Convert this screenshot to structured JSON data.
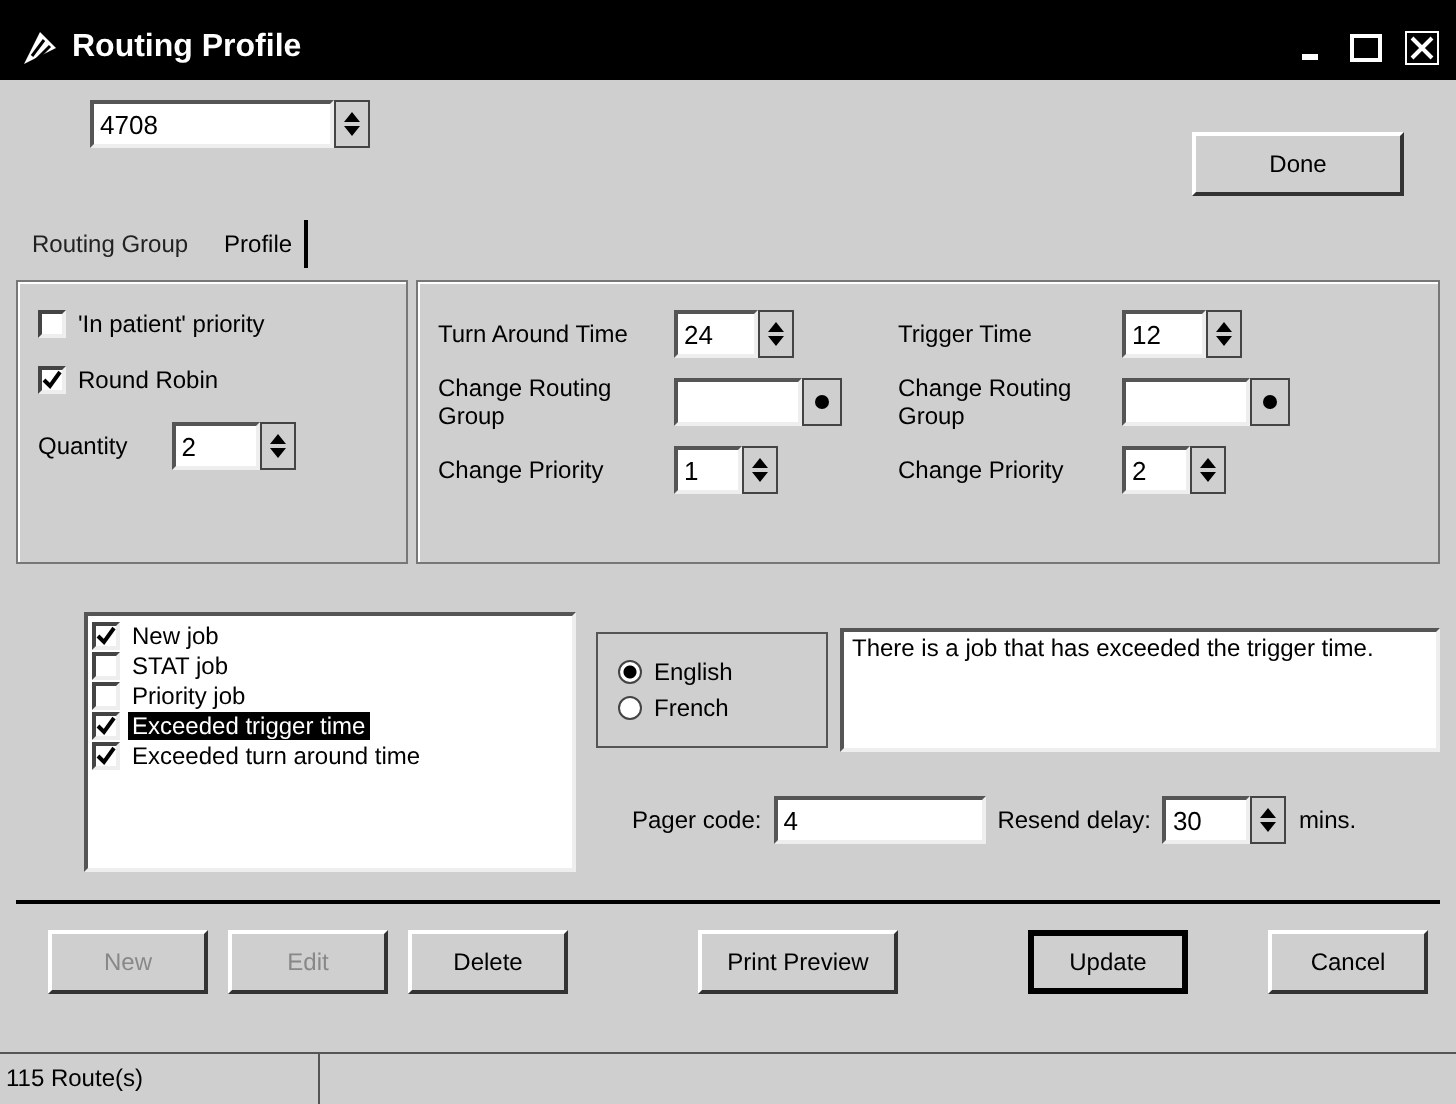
{
  "window": {
    "title": "Routing Profile"
  },
  "record": {
    "value": "4708"
  },
  "done_button": {
    "label": "Done"
  },
  "tabs": [
    {
      "label": "Routing Group",
      "selected": false
    },
    {
      "label": "Profile",
      "selected": true
    }
  ],
  "options": [
    {
      "label": "'In patient' priority",
      "checked": false
    },
    {
      "label": "Round Robin",
      "checked": true
    }
  ],
  "quantity": {
    "label": "Quantity",
    "value": "2"
  },
  "timing": [
    {
      "time_label": "Turn Around Time",
      "time_value": "24",
      "routing_label": "Change Routing Group",
      "priority_label": "Change Priority",
      "priority_value": "1"
    },
    {
      "time_label": "Trigger Time",
      "time_value": "12",
      "routing_label": "Change Routing Group",
      "priority_label": "Change Priority",
      "priority_value": "2"
    }
  ],
  "events": [
    {
      "label": "New job",
      "checked": true,
      "selected": false
    },
    {
      "label": "STAT job",
      "checked": false,
      "selected": false
    },
    {
      "label": "Priority job",
      "checked": false,
      "selected": false
    },
    {
      "label": "Exceeded trigger time",
      "checked": true,
      "selected": true
    },
    {
      "label": "Exceeded turn around time",
      "checked": true,
      "selected": false
    }
  ],
  "languages": [
    {
      "label": "English",
      "selected": true
    },
    {
      "label": "French",
      "selected": false
    }
  ],
  "message": "There is a job that has exceeded the trigger time.",
  "pager_code": {
    "label": "Pager code:",
    "value": "4"
  },
  "resend_delay": {
    "label": "Resend delay:",
    "value": "30",
    "unit": "mins."
  },
  "buttons": [
    {
      "label": "New",
      "disabled": true,
      "default": false
    },
    {
      "label": "Edit",
      "disabled": true,
      "default": false
    },
    {
      "label": "Delete",
      "disabled": false,
      "default": false
    },
    {
      "label": "Print Preview",
      "disabled": false,
      "default": false
    },
    {
      "label": "Update",
      "disabled": false,
      "default": true
    },
    {
      "label": "Cancel",
      "disabled": false,
      "default": false
    }
  ],
  "status_bar": [
    "115 Route(s)"
  ]
}
